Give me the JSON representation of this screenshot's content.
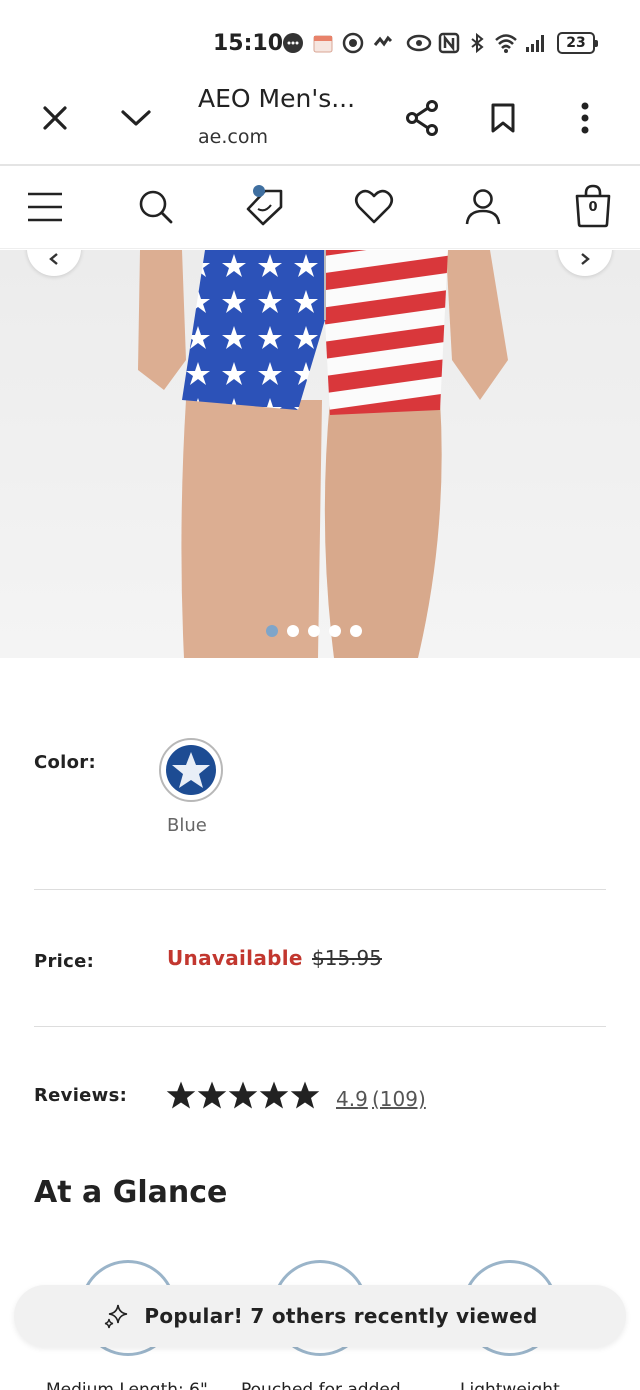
{
  "status_bar": {
    "time": "15:10",
    "battery": "23"
  },
  "browser": {
    "title": "AEO Men's...",
    "url": "ae.com",
    "icons": [
      "close-icon",
      "chevron-down-icon",
      "share-icon",
      "bookmark-icon",
      "more-vert-icon"
    ]
  },
  "nav": {
    "icons": [
      "menu-icon",
      "search-icon",
      "tag-icon",
      "heart-icon",
      "user-icon",
      "bag-icon"
    ],
    "bag_count": "0"
  },
  "product": {
    "image_alt": "Men's flag print boxer brief",
    "carousel_dots": 5,
    "active_dot": 0,
    "color_label": "Color:",
    "color_name": "Blue",
    "price_label": "Price:",
    "price_status": "Unavailable",
    "price_original": "$15.95",
    "reviews_label": "Reviews:",
    "rating": "4.9",
    "review_count": "(109)",
    "stars": 5
  },
  "glance": {
    "title": "At a Glance",
    "features": [
      {
        "caption": "Medium Length: 6\""
      },
      {
        "caption": "Pouched for added"
      },
      {
        "caption": "Lightweight"
      }
    ]
  },
  "toast": {
    "text": "Popular! 7 others recently viewed",
    "icon": "sparkle-icon"
  },
  "colors": {
    "accent_red": "#c2372f",
    "accent_blue": "#3f6fa0",
    "dot_active": "#7fa5c9"
  }
}
